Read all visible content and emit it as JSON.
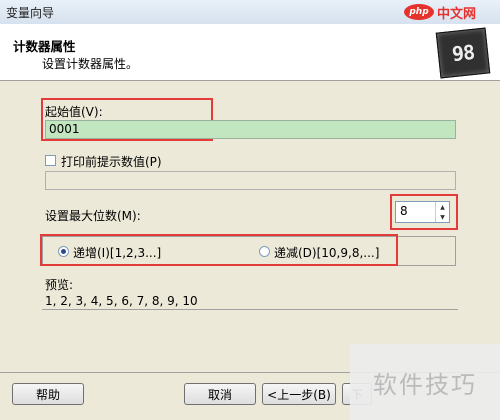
{
  "window": {
    "title": "变量向导"
  },
  "watermark_top": {
    "logo": "php",
    "text": "中文网"
  },
  "header": {
    "title": "计数器属性",
    "subtitle": "设置计数器属性。",
    "icon_digits": "98"
  },
  "start_value": {
    "label": "起始值(V):",
    "value": "0001"
  },
  "prompt_checkbox": {
    "label": "打印前提示数值(P)",
    "checked": false,
    "field_value": ""
  },
  "max_digits": {
    "label": "设置最大位数(M):",
    "value": "8"
  },
  "direction": {
    "options": [
      {
        "label": "递增(I)[1,2,3...]",
        "selected": true
      },
      {
        "label": "递减(D)[10,9,8,...]",
        "selected": false
      }
    ]
  },
  "preview": {
    "label": "预览:",
    "value": "1, 2, 3, 4, 5, 6, 7, 8, 9, 10"
  },
  "buttons": {
    "help": "帮助",
    "cancel": "取消",
    "back": "<上一步(B)",
    "next_partial": "下"
  },
  "watermark_bottom": {
    "text": "软件技巧"
  },
  "colors": {
    "highlight": "#e33a3a",
    "start_value_bg": "#c2e6bf",
    "dialog_bg": "#ece9d8"
  }
}
